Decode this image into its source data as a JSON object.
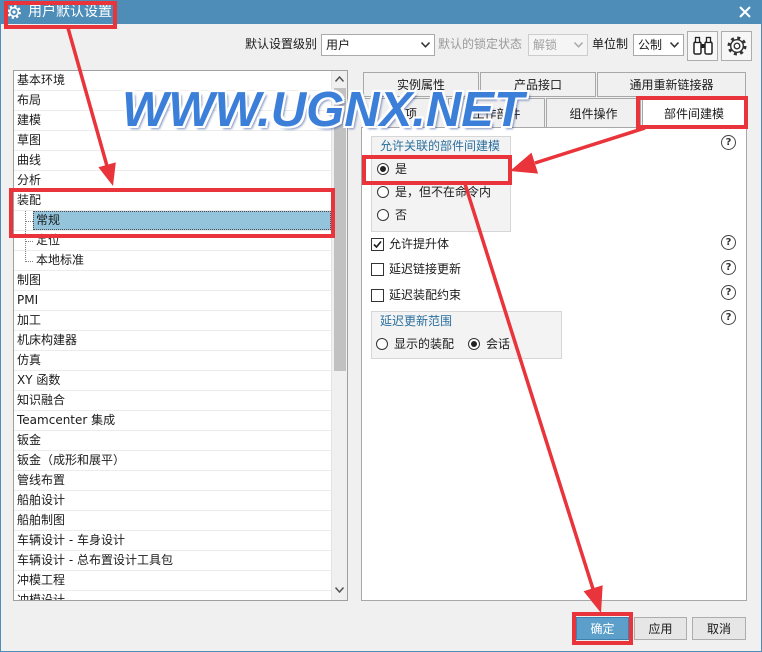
{
  "window": {
    "title": "用户默认设置",
    "title_icon": "gear-icon",
    "close_icon": "close-icon",
    "title_bar_color": "#4d8db8"
  },
  "toolbar": {
    "level_label": "默认设置级别",
    "level_value": "用户",
    "lock_label": "默认的锁定状态",
    "lock_value": "解锁",
    "lock_enabled": false,
    "units_label": "单位制",
    "units_value": "公制",
    "find_icon": "binoculars-icon",
    "settings_icon": "gear-icon"
  },
  "tree": {
    "items": [
      {
        "label": "基本环境",
        "level": 0
      },
      {
        "label": "布局",
        "level": 0
      },
      {
        "label": "建模",
        "level": 0
      },
      {
        "label": "草图",
        "level": 0
      },
      {
        "label": "曲线",
        "level": 0
      },
      {
        "label": "分析",
        "level": 0
      },
      {
        "label": "装配",
        "level": 0
      },
      {
        "label": "常规",
        "level": 1,
        "selected": true
      },
      {
        "label": "定位",
        "level": 1
      },
      {
        "label": "本地标准",
        "level": 1
      },
      {
        "label": "制图",
        "level": 0
      },
      {
        "label": "PMI",
        "level": 0
      },
      {
        "label": "加工",
        "level": 0
      },
      {
        "label": "机床构建器",
        "level": 0
      },
      {
        "label": "仿真",
        "level": 0
      },
      {
        "label": "XY 函数",
        "level": 0
      },
      {
        "label": "知识融合",
        "level": 0
      },
      {
        "label": "Teamcenter 集成",
        "level": 0
      },
      {
        "label": "钣金",
        "level": 0
      },
      {
        "label": "钣金（成形和展平）",
        "level": 0
      },
      {
        "label": "管线布置",
        "level": 0
      },
      {
        "label": "船舶设计",
        "level": 0
      },
      {
        "label": "船舶制图",
        "level": 0
      },
      {
        "label": "车辆设计 - 车身设计",
        "level": 0
      },
      {
        "label": "车辆设计 - 总布置设计工具包",
        "level": 0
      },
      {
        "label": "冲模工程",
        "level": 0
      },
      {
        "label": "冲模设计",
        "level": 0
      }
    ]
  },
  "tabs": {
    "row1": [
      {
        "label": "实例属性"
      },
      {
        "label": "产品接口"
      },
      {
        "label": "通用重新链接器"
      }
    ],
    "row2": [
      {
        "label": "选项"
      },
      {
        "label": "工作部件"
      },
      {
        "label": "组件操作"
      },
      {
        "label": "部件间建模",
        "active": true
      }
    ]
  },
  "interpart_modeling": {
    "associative_group": {
      "title": "允许关联的部件间建模",
      "options": [
        {
          "label": "是",
          "selected": true
        },
        {
          "label": "是，但不在命令内",
          "selected": false
        },
        {
          "label": "否",
          "selected": false
        }
      ]
    },
    "checkboxes": [
      {
        "label": "允许提升体",
        "checked": true
      },
      {
        "label": "延迟链接更新",
        "checked": false
      },
      {
        "label": "延迟装配约束",
        "checked": false
      }
    ],
    "delay_scope_group": {
      "title": "延迟更新范围",
      "options": [
        {
          "label": "显示的装配",
          "selected": false
        },
        {
          "label": "会话",
          "selected": true
        }
      ]
    },
    "help_icon": "help-icon",
    "help_glyph": "?"
  },
  "buttons": {
    "ok": "确定",
    "apply": "应用",
    "cancel": "取消"
  },
  "watermark": "WWW.UGNX.NET",
  "colors": {
    "selection": "#93c4dc",
    "group_title": "#2a6f9e",
    "ok_button": "#5c9fcb",
    "annotation": "#e8343a",
    "watermark": "#3b7fd8"
  }
}
